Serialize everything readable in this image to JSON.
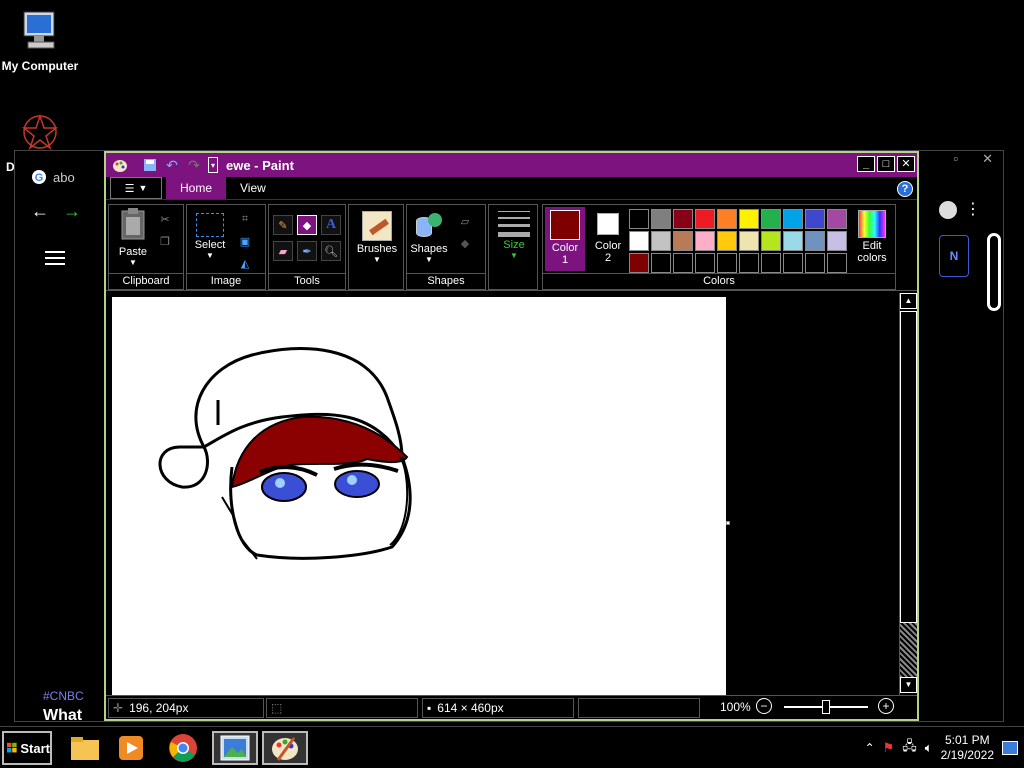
{
  "desktop": {
    "icons": [
      {
        "label": "My Computer"
      },
      {
        "label": "D"
      }
    ]
  },
  "chrome": {
    "tab_title": "abo",
    "side_text_1": "#CNBC",
    "side_text_2": "What",
    "button_text": "N"
  },
  "paint": {
    "title": "ewe - Paint",
    "tabs": {
      "home": "Home",
      "view": "View"
    },
    "groups": {
      "clipboard": "Clipboard",
      "image": "Image",
      "tools": "Tools",
      "shapes": "Shapes",
      "colors": "Colors"
    },
    "buttons": {
      "paste": "Paste",
      "select": "Select",
      "brushes": "Brushes",
      "shapes": "Shapes",
      "size": "Size",
      "color1_a": "Color",
      "color1_b": "1",
      "color2_a": "Color",
      "color2_b": "2",
      "edit_a": "Edit",
      "edit_b": "colors"
    },
    "colors": {
      "color1": "#7f0000",
      "color2": "#ffffff",
      "row1": [
        "#000000",
        "#7f7f7f",
        "#880015",
        "#ed1c24",
        "#ff7f27",
        "#fff200",
        "#22b14c",
        "#00a2e8",
        "#3f48cc",
        "#a349a4"
      ],
      "row2": [
        "#ffffff",
        "#c3c3c3",
        "#b97a57",
        "#ffaec9",
        "#ffc90e",
        "#efe4b0",
        "#b5e61d",
        "#99d9ea",
        "#7092be",
        "#c8bfe7"
      ],
      "row3": [
        "#7f0000",
        "",
        "",
        "",
        "",
        "",
        "",
        "",
        "",
        ""
      ]
    },
    "status": {
      "cursor_pos": "196, 204px",
      "canvas_size": "614 × 460px",
      "zoom": "100%"
    }
  },
  "taskbar": {
    "start": "Start",
    "time": "5:01 PM",
    "date": "2/19/2022"
  }
}
